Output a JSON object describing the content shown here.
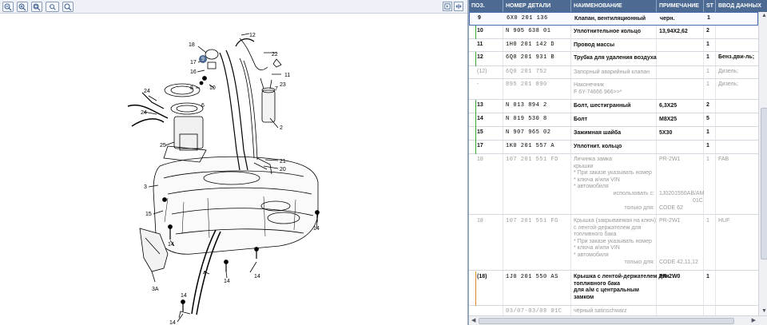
{
  "toolbar": {
    "buttons": [
      "zoom-out-icon",
      "zoom-in-icon",
      "zoom-fit-icon",
      "zoom-window-icon",
      "search-icon"
    ],
    "right_buttons": [
      "pointer-icon",
      "fit-page-icon",
      "move-icon"
    ]
  },
  "diagram": {
    "callouts": [
      "18",
      "12",
      "17",
      "16",
      "9",
      "10",
      "11",
      "7",
      "24",
      "8",
      "6",
      "24",
      "25",
      "2",
      "21",
      "20",
      "23",
      "3",
      "15",
      "14",
      "14",
      "14",
      "3A",
      "4",
      "14",
      "14",
      "14",
      "22"
    ]
  },
  "table": {
    "headers": {
      "pos": "ПОЗ.",
      "number": "НОМЕР ДЕТАЛИ",
      "name": "НАИМЕНОВАНИЕ",
      "note": "ПРИМЕЧАНИЕ",
      "st": "ST",
      "input": "ВВОД ДАННЫХ"
    },
    "rows": [
      {
        "pos": "9",
        "number": "6X0  201  136",
        "name": "Клапан, вентиляционный",
        "note": "черн.",
        "st": "1",
        "input": "",
        "style": "bold",
        "selected": true
      },
      {
        "pos": "10",
        "number": "N   905  638  01",
        "name": "Уплотнительное кольцо",
        "note": "13,94X2,62",
        "st": "2",
        "input": "",
        "style": "bold"
      },
      {
        "pos": "11",
        "number": "1H0  201  142  D",
        "name": "Провод массы",
        "note": "",
        "st": "1",
        "input": "",
        "style": "bold"
      },
      {
        "pos": "12",
        "number": "6Q0  201  931  B",
        "name": "Трубка для удаления воздуха",
        "note": "",
        "st": "1",
        "input": "Бенз.дви-ль;",
        "style": "bold"
      },
      {
        "pos": "(12)",
        "number": "6Q0  201  752",
        "name": "Запорный аварийный клапан",
        "note": "",
        "st": "1",
        "input": "Дизель;",
        "style": "grey"
      },
      {
        "pos": "-",
        "number": "895  201  890",
        "name": "Наконечник",
        "name2": "F 6Y-74666 966>>*",
        "note": "",
        "st": "1",
        "input": "Дизель;",
        "style": "grey"
      },
      {
        "pos": "13",
        "number": "N   013  894  2",
        "name": "Болт, шестигранный",
        "note": "6,3X25",
        "st": "2",
        "input": "",
        "style": "bold"
      },
      {
        "pos": "14",
        "number": "N   019  530  8",
        "name": "Болт",
        "note": "M8X25",
        "st": "5",
        "input": "",
        "style": "bold"
      },
      {
        "pos": "15",
        "number": "N   907  965  02",
        "name": "Зажимная шайба",
        "note": "5X30",
        "st": "1",
        "input": "",
        "style": "bold"
      },
      {
        "pos": "17",
        "number": "1K0  201  557  A",
        "name": "Уплотнит. кольцо",
        "note": "",
        "st": "1",
        "input": "",
        "style": "bold"
      }
    ],
    "row18a": {
      "pos": "18",
      "number": "107  201  551  FD",
      "note": "PR-2W1",
      "st": "1",
      "input": "FAB",
      "lines": [
        "Личинка замка",
        "крышки",
        "* При заказе указывать номер",
        "* ключа и/или VIN",
        "* автомобиля"
      ],
      "use_label": "использовать с:",
      "use_value": "1J0201550AB/AM",
      "use_value2": "01C",
      "only_label": "только для:",
      "only_value": "CODE 62"
    },
    "row18b": {
      "pos": "18",
      "number": "107  201  551  FG",
      "note": "PR-2W1",
      "st": "1",
      "input": "HUF",
      "lines": [
        "Крышка (закрываемая на ключ)",
        "с лентой-держателем для",
        "топливного бака",
        "* При заказе указывать номер",
        "* ключа и/или VIN",
        "* автомобиля"
      ],
      "only_label": "только для:",
      "only_value": "CODE 42,11,12"
    },
    "row18c": {
      "pos": "(18)",
      "number": "1J0  201  550  AS",
      "note": "PR-2W0",
      "st": "1",
      "input": "",
      "lines": [
        "Крышка с лентой-держателем для",
        "топливного бака",
        "для а/м с центральным",
        "замком"
      ]
    },
    "row_last": {
      "number": "03/07-03/08  01C",
      "name": "чёрный satinschwarz"
    }
  },
  "colors": {
    "header_bg": "#4c6a92",
    "marker_green": "#3aa43a",
    "marker_orange": "#e08a2a",
    "selection_border": "#4b6cb0"
  }
}
